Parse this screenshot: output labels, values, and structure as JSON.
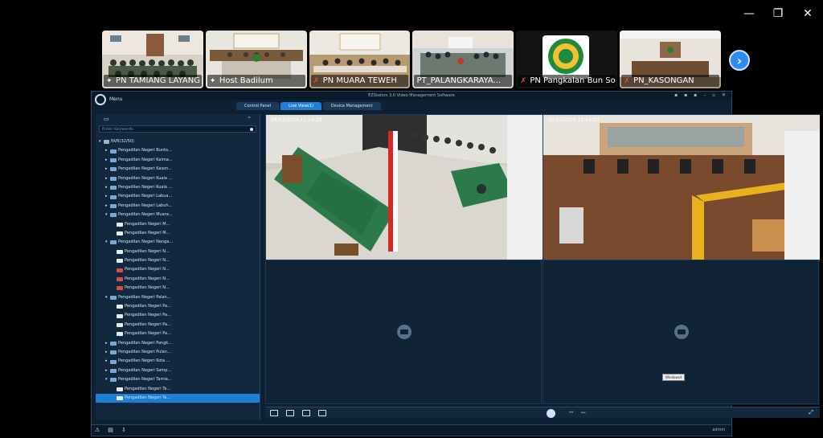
{
  "window_controls": {
    "minimize": "—",
    "restore": "❐",
    "close": "✕"
  },
  "participants": [
    {
      "name": "PN TAMIANG LAYANG",
      "muted": false,
      "active": true
    },
    {
      "name": "Host Badilum",
      "muted": false,
      "active": false
    },
    {
      "name": "PN MUARA TEWEH",
      "muted": true,
      "active": false
    },
    {
      "name": "PT_PALANGKARAYA...",
      "muted": false,
      "active": false
    },
    {
      "name": "PN Pangkalan Bun So...",
      "muted": true,
      "active": false
    },
    {
      "name": "PN_KASONGAN",
      "muted": true,
      "active": false
    }
  ],
  "next_button": "›",
  "app": {
    "title": "EZStation 3.0 Video Management Software",
    "menu_label": "Menu",
    "window_icons": "▪ ▪ ▪ – ▫ ✕",
    "tabs": [
      {
        "label": "Control Panel",
        "active": false
      },
      {
        "label": "Live View(1)",
        "active": true
      },
      {
        "label": "Device Management",
        "active": false
      }
    ],
    "search_placeholder": "Enter Keywords",
    "tree": [
      {
        "label": "NVR(32/50)",
        "level": 0,
        "icon": "nvr",
        "exp": "▾"
      },
      {
        "label": "Pengadilan Negeri Bunto...",
        "level": 1,
        "icon": "grp",
        "exp": "▸"
      },
      {
        "label": "Pengadilan Negeri Kaima...",
        "level": 1,
        "icon": "grp",
        "exp": "▸"
      },
      {
        "label": "Pengadilan Negeri Kason...",
        "level": 1,
        "icon": "grp",
        "exp": "▸"
      },
      {
        "label": "Pengadilan Negeri Kuala ...",
        "level": 1,
        "icon": "grp",
        "exp": "▸"
      },
      {
        "label": "Pengadilan Negeri Kuala ...",
        "level": 1,
        "icon": "grp",
        "exp": "▸"
      },
      {
        "label": "Pengadilan Negeri Labua...",
        "level": 1,
        "icon": "grp",
        "exp": "▸"
      },
      {
        "label": "Pengadilan Negeri Labuh...",
        "level": 1,
        "icon": "grp",
        "exp": "▸"
      },
      {
        "label": "Pengadilan Negeri Muara...",
        "level": 1,
        "icon": "grp",
        "exp": "▾"
      },
      {
        "label": "Pengadilan Negeri M...",
        "level": 2,
        "icon": "cam",
        "exp": ""
      },
      {
        "label": "Pengadilan Negeri M...",
        "level": 2,
        "icon": "cam",
        "exp": ""
      },
      {
        "label": "Pengadilan Negeri Nanga...",
        "level": 1,
        "icon": "grp",
        "exp": "▾"
      },
      {
        "label": "Pengadilan Negeri N...",
        "level": 2,
        "icon": "cam",
        "exp": ""
      },
      {
        "label": "Pengadilan Negeri N...",
        "level": 2,
        "icon": "cam",
        "exp": ""
      },
      {
        "label": "Pengadilan Negeri N...",
        "level": 2,
        "icon": "camred",
        "exp": ""
      },
      {
        "label": "Pengadilan Negeri N...",
        "level": 2,
        "icon": "camred",
        "exp": ""
      },
      {
        "label": "Pengadilan Negeri N...",
        "level": 2,
        "icon": "camred",
        "exp": ""
      },
      {
        "label": "Pengadilan Negeri Palan...",
        "level": 1,
        "icon": "grp",
        "exp": "▾"
      },
      {
        "label": "Pengadilan Negeri Pa...",
        "level": 2,
        "icon": "cam",
        "exp": ""
      },
      {
        "label": "Pengadilan Negeri Pa...",
        "level": 2,
        "icon": "cam",
        "exp": ""
      },
      {
        "label": "Pengadilan Negeri Pa...",
        "level": 2,
        "icon": "cam",
        "exp": ""
      },
      {
        "label": "Pengadilan Negeri Pa...",
        "level": 2,
        "icon": "cam",
        "exp": ""
      },
      {
        "label": "Pengadilan Negeri Pangk...",
        "level": 1,
        "icon": "grp",
        "exp": "▸"
      },
      {
        "label": "Pengadilan Negeri Pulan...",
        "level": 1,
        "icon": "grp",
        "exp": "▸"
      },
      {
        "label": "Pengadilan Negeri Kota ...",
        "level": 1,
        "icon": "grp",
        "exp": "▸"
      },
      {
        "label": "Pengadilan Negeri Samp...",
        "level": 1,
        "icon": "grp",
        "exp": "▸"
      },
      {
        "label": "Pengadilan Negeri Tamia...",
        "level": 1,
        "icon": "grp",
        "exp": "▾"
      },
      {
        "label": "Pengadilan Negeri Ta...",
        "level": 2,
        "icon": "cam",
        "exp": ""
      },
      {
        "label": "Pengadilan Negeri Ta...",
        "level": 2,
        "icon": "cam",
        "exp": "",
        "selected": true
      }
    ],
    "cells": [
      {
        "timestamp": "09/07/2024 11:14:20",
        "kind": "court-green"
      },
      {
        "timestamp": "09/07/2024 11:14:20",
        "kind": "court-wood"
      },
      {
        "timestamp": "",
        "kind": "empty"
      },
      {
        "timestamp": "",
        "kind": "empty"
      }
    ],
    "tooltip": "Windows4",
    "user": "admin"
  }
}
